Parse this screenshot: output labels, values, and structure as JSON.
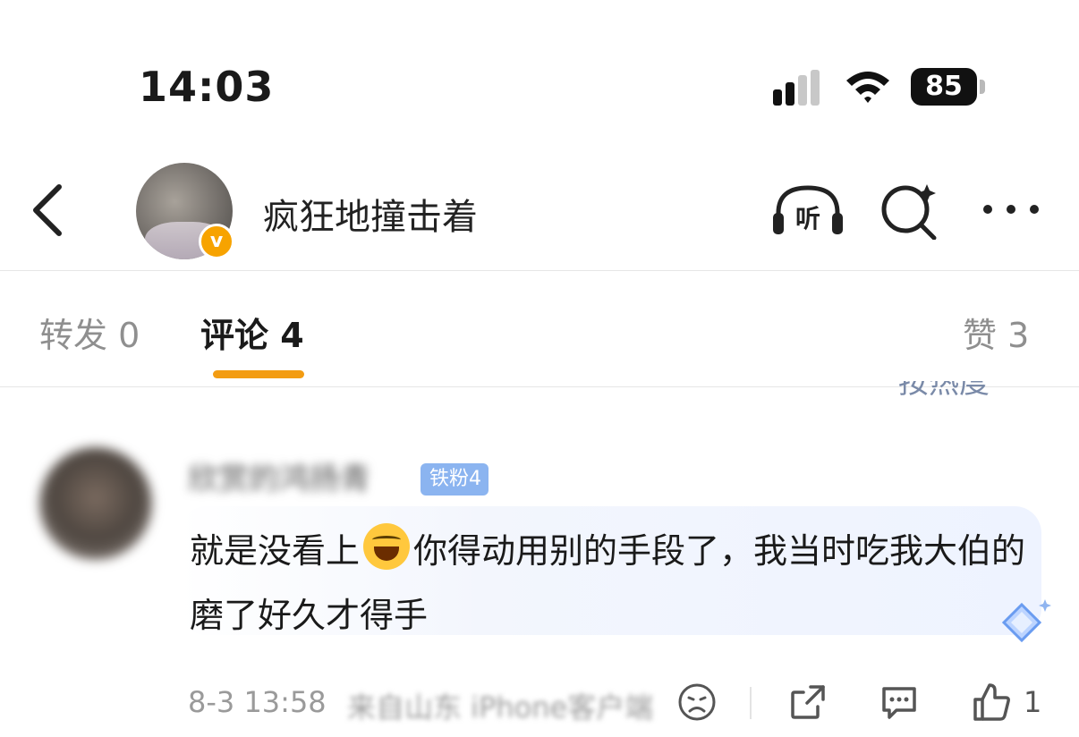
{
  "status_bar": {
    "time": "14:03",
    "battery": "85"
  },
  "header": {
    "username": "疯狂地撞击着",
    "badge": "v",
    "listen_label": "听"
  },
  "tabs": {
    "repost": "转发 0",
    "comments": "评论 4",
    "likes": "赞 3"
  },
  "sort_label": "按热度",
  "comment": {
    "author": "欣赏的鸿扬青",
    "fan_badge": "铁粉4",
    "text_before_emoji": "就是没看上",
    "text_after_emoji": "你得动用别的手段了，我当时吃我大伯的磨了好久才得手",
    "time": "8-3 13:58",
    "source": "来自山东 iPhone客户端",
    "like_count": "1"
  },
  "colors": {
    "accent": "#f39c12",
    "vip": "#f7a300",
    "fan_badge": "#8bb4f0"
  }
}
